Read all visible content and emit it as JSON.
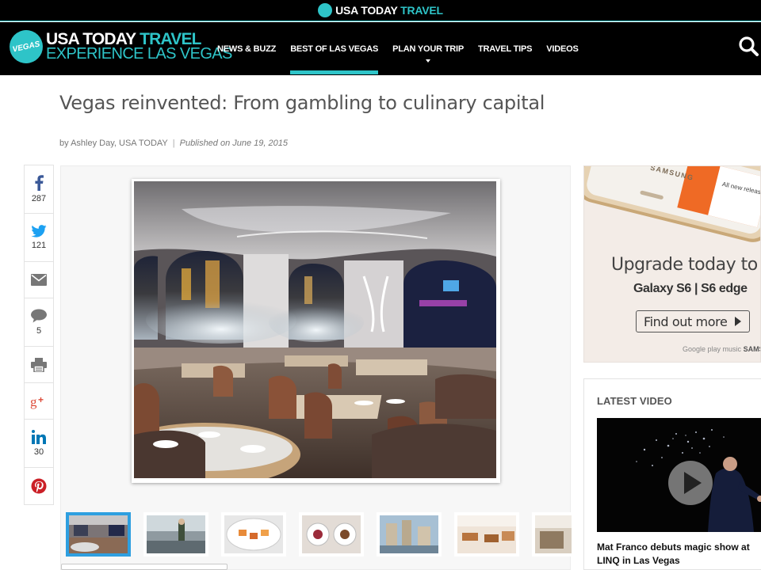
{
  "topbar": {
    "brand_main": "USA TODAY",
    "brand_accent": "TRAVEL"
  },
  "brand": {
    "badge": "VEGAS",
    "line1_main": "USA TODAY",
    "line1_accent": "TRAVEL",
    "line2": "EXPERIENCE LAS VEGAS"
  },
  "nav": {
    "items": [
      {
        "label": "NEWS & BUZZ"
      },
      {
        "label": "BEST OF LAS VEGAS"
      },
      {
        "label": "PLAN YOUR TRIP"
      },
      {
        "label": "TRAVEL TIPS"
      },
      {
        "label": "VIDEOS"
      }
    ],
    "active_index": 1,
    "search_icon": "search-icon"
  },
  "article": {
    "title": "Vegas reinvented: From gambling to culinary capital",
    "author": "by Ashley Day, USA TODAY",
    "separator": "|",
    "published": "Published on June 19, 2015"
  },
  "share": [
    {
      "icon": "facebook-icon",
      "count": "287"
    },
    {
      "icon": "twitter-icon",
      "count": "121"
    },
    {
      "icon": "email-icon",
      "count": ""
    },
    {
      "icon": "comment-icon",
      "count": "5"
    },
    {
      "icon": "print-icon",
      "count": ""
    },
    {
      "icon": "google-plus-icon",
      "count": ""
    },
    {
      "icon": "linkedin-icon",
      "count": "30"
    },
    {
      "icon": "pinterest-icon",
      "count": ""
    }
  ],
  "gallery": {
    "main_photo": "restaurant-dining-room-photo",
    "active_thumb": 0,
    "thumbs": [
      "restaurant-interior-thumb",
      "chef-in-kitchen-thumb",
      "plated-appetizers-thumb",
      "dessert-plates-thumb",
      "bellagio-fountains-thumb",
      "dining-room-thumb",
      "buffet-thumb"
    ]
  },
  "ad": {
    "headline": "Upgrade today to",
    "subline": "Galaxy S6 | S6 edge",
    "cta": "Find out more",
    "footer_main": "Google play music",
    "footer_brand": "SAMSUNG",
    "screen_text": "All new releases",
    "phone_brand": "SAMSUNG"
  },
  "latest_video": {
    "heading": "LATEST VIDEO",
    "caption_line1": "Mat Franco debuts magic show at",
    "caption_line2": "LINQ in Las Vegas"
  },
  "colors": {
    "accent": "#2ec4c8",
    "nav_bg": "#000000",
    "thumb_active": "#2e9fe0",
    "pinterest": "#cb2027",
    "google_plus": "#dd4b39",
    "facebook": "#3b5998",
    "twitter": "#1da1f2",
    "linkedin": "#0077b5"
  }
}
